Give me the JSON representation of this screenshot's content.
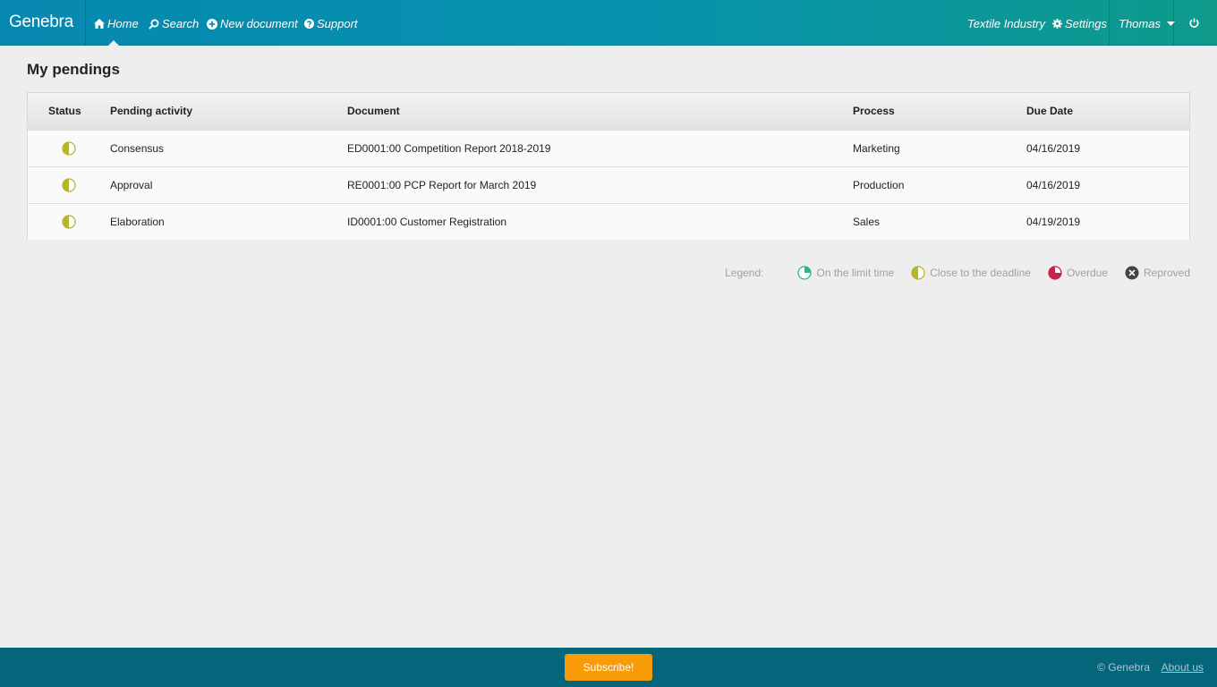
{
  "navbar": {
    "brand": "Genebra",
    "items": [
      {
        "label": "Home",
        "icon": "home-icon"
      },
      {
        "label": "Search",
        "icon": "search-icon"
      },
      {
        "label": "New document",
        "icon": "plus-circle-icon"
      },
      {
        "label": "Support",
        "icon": "question-circle-icon"
      }
    ],
    "company": "Textile Industry",
    "settings_label": "Settings",
    "settings_icon": "gear-icon",
    "user_name": "Thomas",
    "user_icon": "caret-down-icon",
    "power_icon": "power-icon",
    "gradient_colors": [
      "#0788b0",
      "#0f9a8c"
    ]
  },
  "main": {
    "title": "My pendings",
    "table": {
      "columns": [
        "Status",
        "Pending activity",
        "Document",
        "Process",
        "Due Date"
      ],
      "rows": [
        {
          "status": "close-to-deadline",
          "activity": "Consensus",
          "document": "ED0001:00 Competition Report 2018-2019",
          "process": "Marketing",
          "due": "04/16/2019"
        },
        {
          "status": "close-to-deadline",
          "activity": "Approval",
          "document": "RE0001:00 PCP Report for March 2019",
          "process": "Production",
          "due": "04/16/2019"
        },
        {
          "status": "close-to-deadline",
          "activity": "Elaboration",
          "document": "ID0001:00 Customer Registration",
          "process": "Sales",
          "due": "04/19/2019"
        }
      ]
    },
    "legend": {
      "label": "Legend:",
      "items": [
        {
          "label": "On the limit time",
          "icon": "quarter-pie-icon",
          "color": "#2fb38f"
        },
        {
          "label": "Close to the deadline",
          "icon": "half-pie-icon",
          "color": "#b7b52b"
        },
        {
          "label": "Overdue",
          "icon": "three-quarter-pie-icon",
          "color": "#c4244b"
        },
        {
          "label": "Reproved",
          "icon": "x-circle-icon",
          "color": "#444444"
        }
      ]
    }
  },
  "footer": {
    "subscribe_label": "Subscribe!",
    "copyright": "© Genebra",
    "about_label": "About us",
    "accent_color": "#f79b09",
    "background_color": "#05657a"
  }
}
